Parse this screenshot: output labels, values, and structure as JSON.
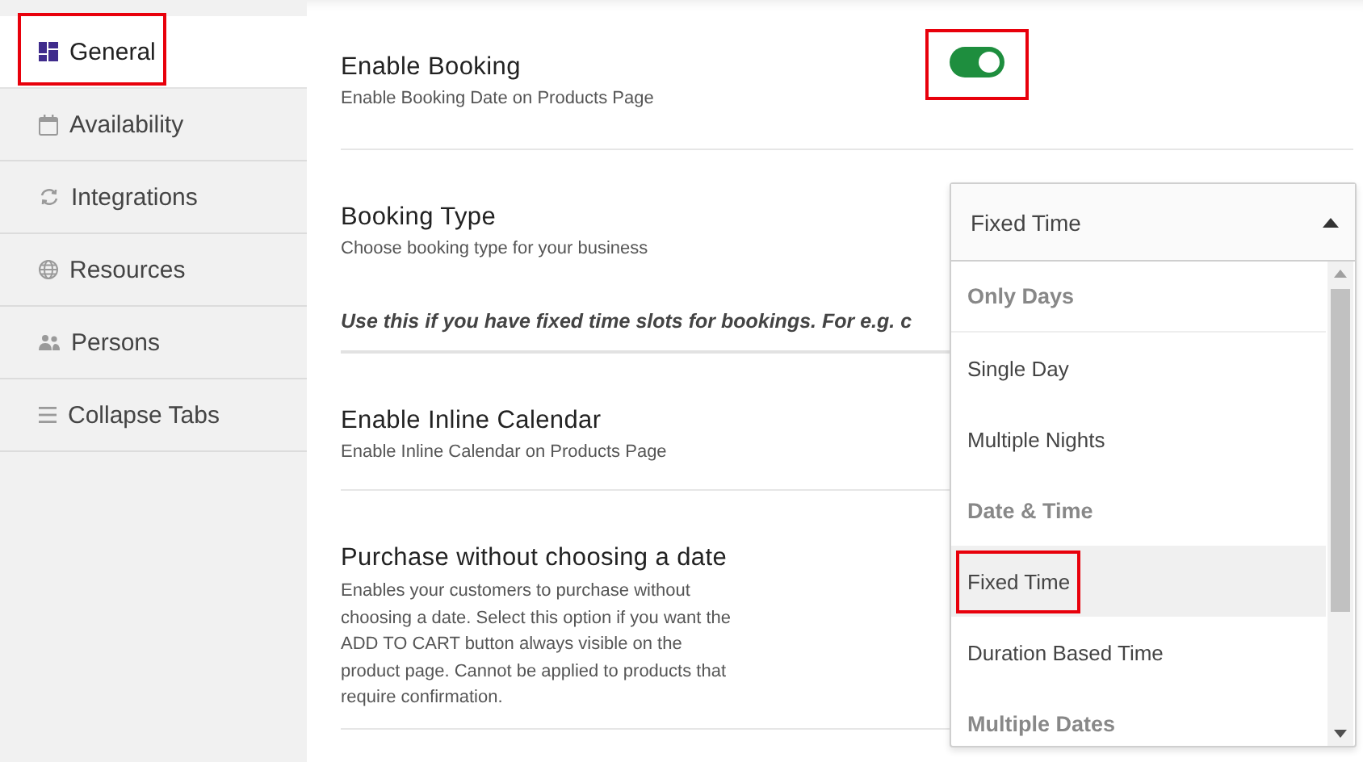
{
  "sidebar": {
    "items": [
      {
        "label": "General",
        "selected": true,
        "highlighted": true
      },
      {
        "label": "Availability",
        "selected": false,
        "highlighted": false
      },
      {
        "label": "Integrations",
        "selected": false,
        "highlighted": false
      },
      {
        "label": "Resources",
        "selected": false,
        "highlighted": false
      },
      {
        "label": "Persons",
        "selected": false,
        "highlighted": false
      },
      {
        "label": "Collapse Tabs",
        "selected": false,
        "highlighted": false
      }
    ]
  },
  "settings": [
    {
      "kind": "toggle",
      "title": "Enable Booking",
      "description": "Enable Booking Date on Products Page",
      "on": true,
      "highlighted": true
    },
    {
      "kind": "select",
      "title": "Booking Type",
      "description": "Choose booking type for your business",
      "note": "Use this if you have fixed time slots for bookings. For e.g. c"
    },
    {
      "kind": "plain",
      "title": "Enable Inline Calendar",
      "description": "Enable Inline Calendar on Products Page"
    },
    {
      "kind": "plain",
      "title": "Purchase without choosing a date",
      "description": "Enables your customers to purchase without choosing a date. Select this option if you want the ADD TO CART button always visible on the product page. Cannot be applied to products that require confirmation."
    }
  ],
  "dropdown": {
    "value": "Fixed Time",
    "expanded": true,
    "options": [
      {
        "kind": "group",
        "label": "Only Days"
      },
      {
        "kind": "option",
        "label": "Single Day",
        "selected": false,
        "highlighted": false
      },
      {
        "kind": "option",
        "label": "Multiple Nights",
        "selected": false,
        "highlighted": false
      },
      {
        "kind": "group",
        "label": "Date & Time"
      },
      {
        "kind": "option",
        "label": "Fixed Time",
        "selected": true,
        "highlighted": true
      },
      {
        "kind": "option",
        "label": "Duration Based Time",
        "selected": false,
        "highlighted": false
      },
      {
        "kind": "group",
        "label": "Multiple Dates"
      }
    ]
  }
}
